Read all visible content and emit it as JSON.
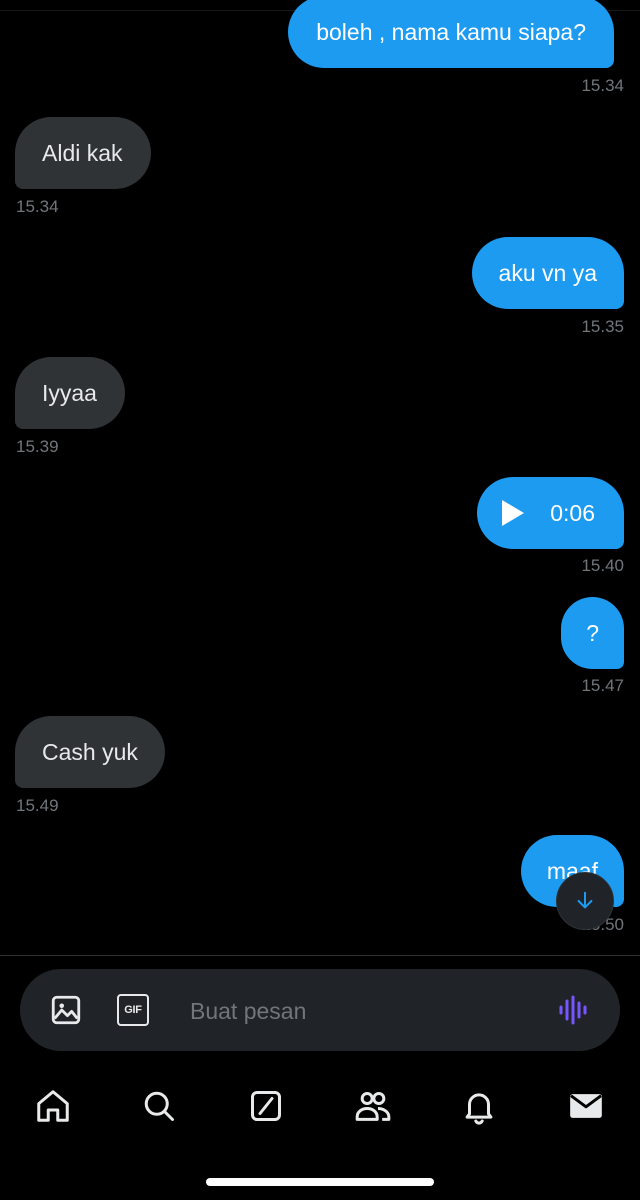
{
  "messages": [
    {
      "direction": "out",
      "text": "boleh , nama kamu siapa?",
      "time": "15.34"
    },
    {
      "direction": "in",
      "text": "Aldi kak",
      "time": "15.34"
    },
    {
      "direction": "out",
      "text": "aku vn ya",
      "time": "15.35"
    },
    {
      "direction": "in",
      "text": "Iyyaa",
      "time": "15.39"
    },
    {
      "direction": "out",
      "type": "voice",
      "duration": "0:06",
      "time": "15.40"
    },
    {
      "direction": "out",
      "text": "?",
      "time": "15.47"
    },
    {
      "direction": "in",
      "text": "Cash yuk",
      "time": "15.49"
    },
    {
      "direction": "out",
      "text": "maaf",
      "time": "15.50"
    }
  ],
  "composer": {
    "placeholder": "Buat pesan",
    "gif_label": "GIF"
  },
  "icons": {
    "image": "image-icon",
    "gif": "gif-icon",
    "voice": "voice-wave-icon",
    "scroll_down": "arrow-down-icon",
    "nav": [
      "home-icon",
      "search-icon",
      "grok-icon",
      "communities-icon",
      "notifications-icon",
      "messages-icon"
    ]
  },
  "colors": {
    "background": "#000000",
    "outgoing_bubble": "#1d9bf0",
    "incoming_bubble": "#2f3336",
    "timestamp": "#71767b",
    "voice_icon": "#7856ff"
  }
}
